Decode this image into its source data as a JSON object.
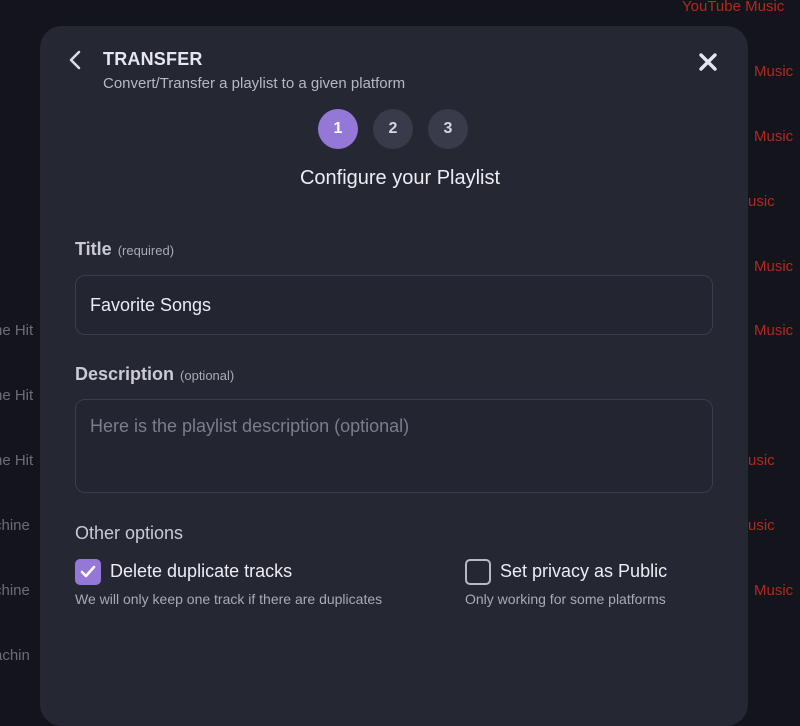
{
  "background": {
    "left_items": [
      "ne Hit",
      "ne Hit",
      "ne Hit",
      "chine",
      "chine",
      "achin"
    ],
    "right_items": [
      "YouTube Music",
      "Music",
      "Music",
      "usic",
      "Music",
      "Music",
      "usic",
      "usic",
      "Music"
    ]
  },
  "header": {
    "title": "TRANSFER",
    "subtitle": "Convert/Transfer a playlist to a given platform"
  },
  "steps": [
    {
      "label": "1",
      "active": true
    },
    {
      "label": "2",
      "active": false
    },
    {
      "label": "3",
      "active": false
    }
  ],
  "section_title": "Configure your Playlist",
  "form": {
    "title_label": "Title",
    "title_hint": "(required)",
    "title_value": "Favorite Songs",
    "description_label": "Description",
    "description_hint": "(optional)",
    "description_placeholder": "Here is the playlist description (optional)"
  },
  "options": {
    "heading": "Other options",
    "items": [
      {
        "label": "Delete duplicate tracks",
        "note": "We will only keep one track if there are duplicates",
        "checked": true
      },
      {
        "label": "Set privacy as Public",
        "note": "Only working for some platforms",
        "checked": false
      }
    ]
  },
  "colors": {
    "accent": "#9577d8",
    "modal_bg": "#252733",
    "page_bg": "#14151c",
    "brand_red": "#b2291f"
  }
}
